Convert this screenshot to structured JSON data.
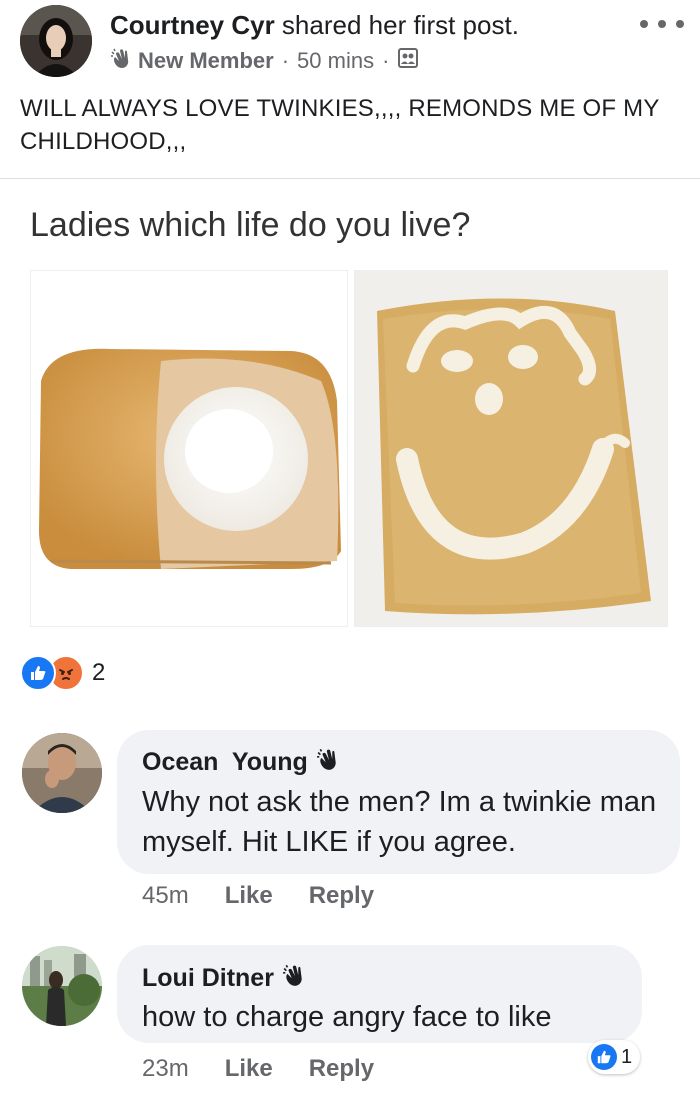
{
  "post": {
    "author_name": "Courtney Cyr",
    "author_action": " shared her first post.",
    "badge": "New Member",
    "time": "50 mins",
    "separator": "·",
    "text": "WILL ALWAYS LOVE TWINKIES,,,, REMONDS ME OF MY CHILDHOOD,,,",
    "icons": [
      "wave-icon",
      "audience-group-icon",
      "more-options-icon"
    ]
  },
  "meme": {
    "caption": "Ladies which life do you live?",
    "colors": {
      "cake": "#d9a458",
      "cream": "#ffffff",
      "bar": "#d4ad6a",
      "icing": "#f3eee0"
    }
  },
  "reactions": {
    "count": "2",
    "types": [
      "like",
      "angry"
    ],
    "colors": {
      "like": "#1877f2",
      "angry": "#f0743a"
    }
  },
  "comments": [
    {
      "name": "Ocean  Young",
      "text": "Why not ask the men? Im a twinkie man myself. Hit LIKE if you agree.",
      "time": "45m",
      "like_label": "Like",
      "reply_label": "Reply"
    },
    {
      "name": "Loui Ditner",
      "text": "how to charge angry face to like",
      "time": "23m",
      "like_label": "Like",
      "reply_label": "Reply",
      "reaction_count": "1"
    }
  ]
}
